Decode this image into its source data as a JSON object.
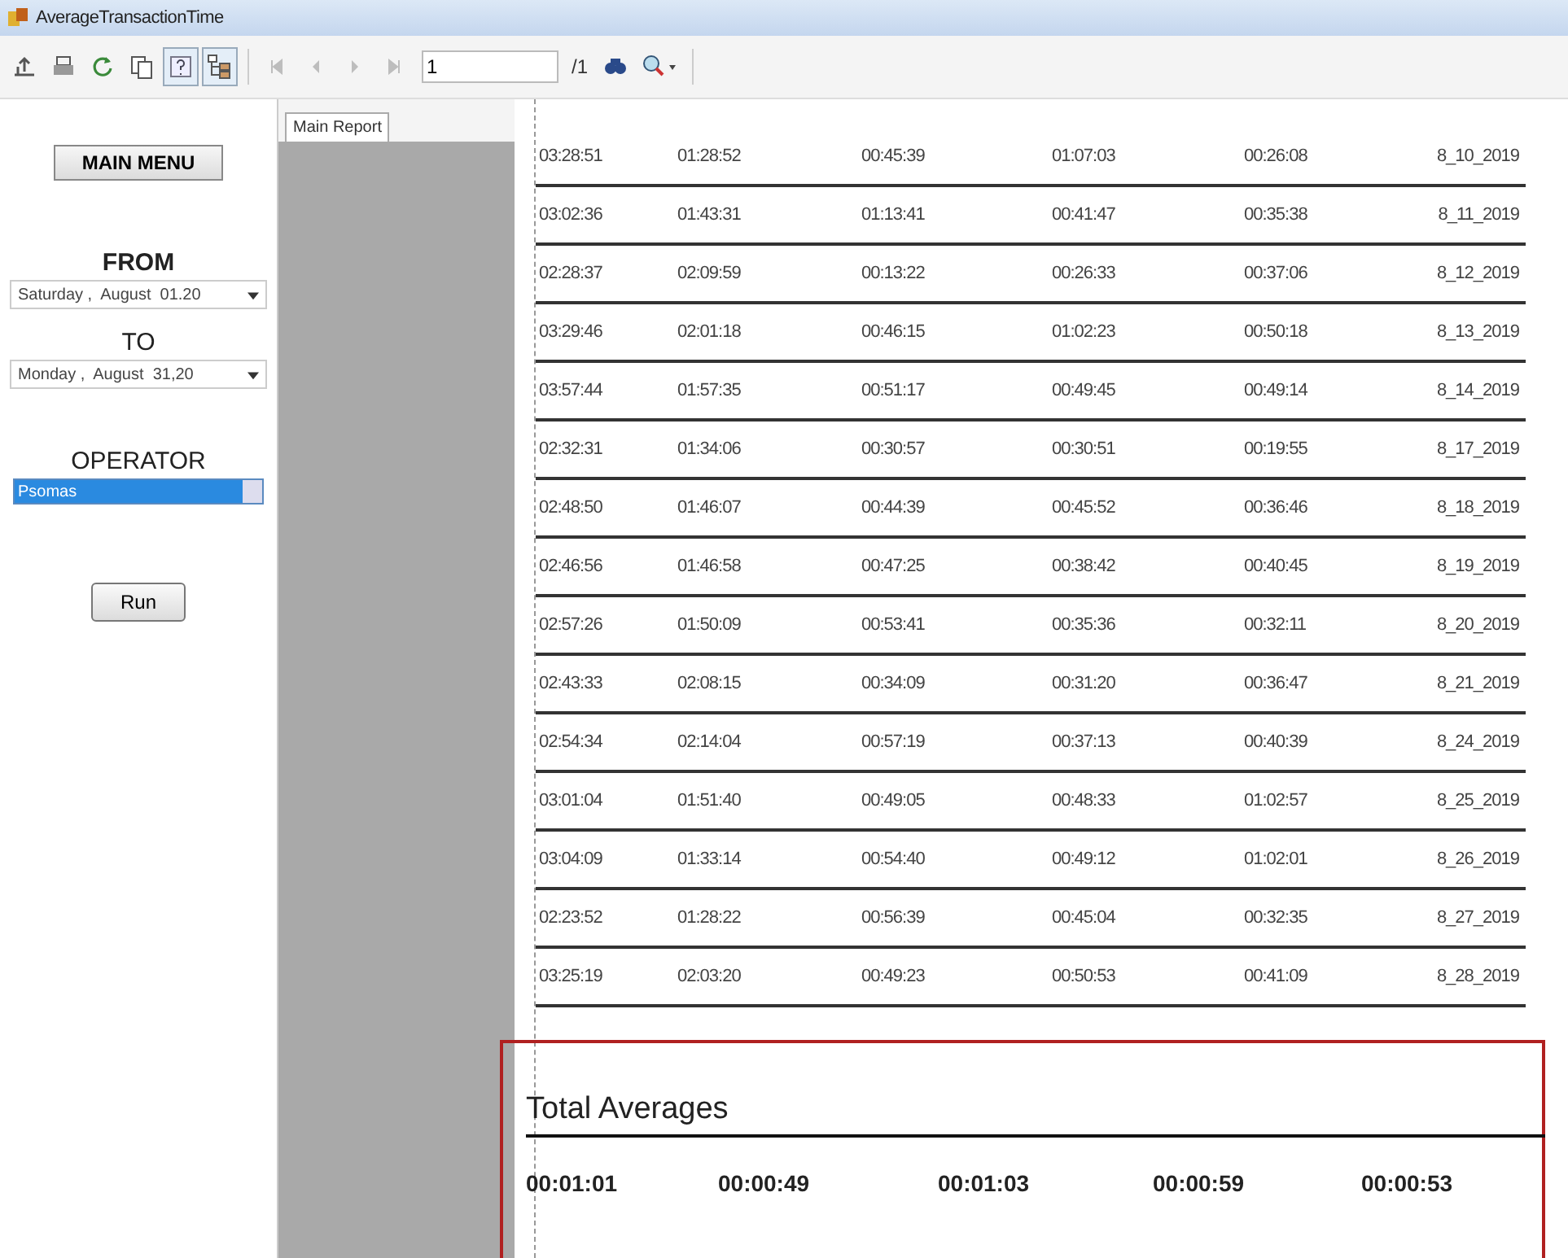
{
  "window": {
    "title": "AverageTransactionTime"
  },
  "toolbar": {
    "buttons": [
      {
        "kind": "export",
        "on": false,
        "disabled": false
      },
      {
        "kind": "print",
        "on": false,
        "disabled": false
      },
      {
        "kind": "refresh",
        "on": false,
        "disabled": false
      },
      {
        "kind": "copy",
        "on": false,
        "disabled": false
      },
      {
        "kind": "help",
        "on": true,
        "disabled": false
      },
      {
        "kind": "tree",
        "on": true,
        "disabled": false
      }
    ],
    "nav": [
      {
        "kind": "first",
        "disabled": true
      },
      {
        "kind": "prev",
        "disabled": true
      },
      {
        "kind": "next",
        "disabled": true
      },
      {
        "kind": "last",
        "disabled": true
      }
    ],
    "page": "1",
    "page_total": "/1"
  },
  "sidebar": {
    "main_menu": "MAIN MENU",
    "from_label": "FROM",
    "from_value": "Saturday ,  August  01.20",
    "to_label": "TO",
    "to_value": "Monday ,  August  31,20",
    "operator_label": "OPERATOR",
    "operator_value": "Psomas",
    "run": "Run"
  },
  "tabs": [
    {
      "label": "Main Report",
      "selected": true
    }
  ],
  "rows": [
    [
      "03:28:51",
      "01:28:52",
      "00:45:39",
      "01:07:03",
      "00:26:08",
      "8_10_2019"
    ],
    [
      "03:02:36",
      "01:43:31",
      "01:13:41",
      "00:41:47",
      "00:35:38",
      "8_11_2019"
    ],
    [
      "02:28:37",
      "02:09:59",
      "00:13:22",
      "00:26:33",
      "00:37:06",
      "8_12_2019"
    ],
    [
      "03:29:46",
      "02:01:18",
      "00:46:15",
      "01:02:23",
      "00:50:18",
      "8_13_2019"
    ],
    [
      "03:57:44",
      "01:57:35",
      "00:51:17",
      "00:49:45",
      "00:49:14",
      "8_14_2019"
    ],
    [
      "02:32:31",
      "01:34:06",
      "00:30:57",
      "00:30:51",
      "00:19:55",
      "8_17_2019"
    ],
    [
      "02:48:50",
      "01:46:07",
      "00:44:39",
      "00:45:52",
      "00:36:46",
      "8_18_2019"
    ],
    [
      "02:46:56",
      "01:46:58",
      "00:47:25",
      "00:38:42",
      "00:40:45",
      "8_19_2019"
    ],
    [
      "02:57:26",
      "01:50:09",
      "00:53:41",
      "00:35:36",
      "00:32:11",
      "8_20_2019"
    ],
    [
      "02:43:33",
      "02:08:15",
      "00:34:09",
      "00:31:20",
      "00:36:47",
      "8_21_2019"
    ],
    [
      "02:54:34",
      "02:14:04",
      "00:57:19",
      "00:37:13",
      "00:40:39",
      "8_24_2019"
    ],
    [
      "03:01:04",
      "01:51:40",
      "00:49:05",
      "00:48:33",
      "01:02:57",
      "8_25_2019"
    ],
    [
      "03:04:09",
      "01:33:14",
      "00:54:40",
      "00:49:12",
      "01:02:01",
      "8_26_2019"
    ],
    [
      "02:23:52",
      "01:28:22",
      "00:56:39",
      "00:45:04",
      "00:32:35",
      "8_27_2019"
    ],
    [
      "03:25:19",
      "02:03:20",
      "00:49:23",
      "00:50:53",
      "00:41:09",
      "8_28_2019"
    ]
  ],
  "totals": {
    "title": "Total Averages",
    "values": [
      "00:01:01",
      "00:00:49",
      "00:01:03",
      "00:00:59",
      "00:00:53"
    ]
  }
}
